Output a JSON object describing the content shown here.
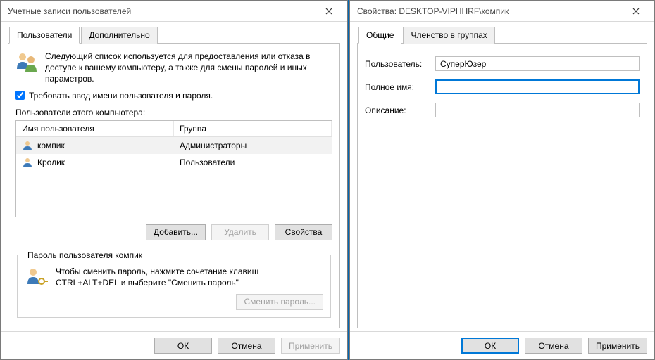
{
  "left": {
    "title": "Учетные записи пользователей",
    "tabs": {
      "users": "Пользователи",
      "advanced": "Дополнительно"
    },
    "description": "Следующий список используется для предоставления или отказа в доступе к вашему компьютеру, а также для смены паролей и иных параметров.",
    "require_login_label": "Требовать ввод имени пользователя и пароля.",
    "list_label": "Пользователи этого компьютера:",
    "columns": {
      "user": "Имя пользователя",
      "group": "Группа"
    },
    "rows": [
      {
        "name": "компик",
        "group": "Администраторы",
        "selected": true
      },
      {
        "name": "Кролик",
        "group": "Пользователи",
        "selected": false
      }
    ],
    "buttons": {
      "add": "Добавить...",
      "remove": "Удалить",
      "props": "Свойства"
    },
    "pw_group_title": "Пароль пользователя компик",
    "pw_text": "Чтобы сменить пароль, нажмите сочетание клавиш CTRL+ALT+DEL и выберите \"Сменить пароль\"",
    "pw_button": "Сменить пароль...",
    "footer": {
      "ok": "ОК",
      "cancel": "Отмена",
      "apply": "Применить"
    }
  },
  "right": {
    "title": "Свойства: DESKTOP-VIPHHRF\\компик",
    "tabs": {
      "general": "Общие",
      "membership": "Членство в группах"
    },
    "labels": {
      "user": "Пользователь:",
      "fullname": "Полное имя:",
      "description": "Описание:"
    },
    "values": {
      "user": "СуперЮзер",
      "fullname": "",
      "description": ""
    },
    "footer": {
      "ok": "ОК",
      "cancel": "Отмена",
      "apply": "Применить"
    }
  }
}
